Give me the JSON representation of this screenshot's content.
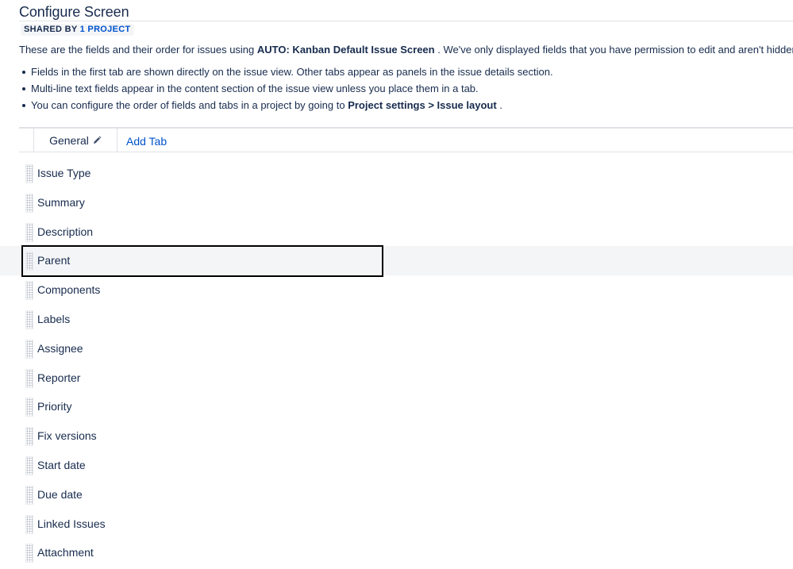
{
  "page": {
    "title": "Configure Screen",
    "shared_by_label": "SHARED BY",
    "shared_by_link": "1 PROJECT",
    "intro_pre": "These are the fields and their order for issues using ",
    "intro_screen": "AUTO: Kanban Default Issue Screen",
    "intro_post": " . We've only displayed fields that you have permission to edit and aren't hidden.",
    "bullet_1": "Fields in the first tab are shown directly on the issue view. Other tabs appear as panels in the issue details section.",
    "bullet_2": "Multi-line text fields appear in the content section of the issue view unless you place them in a tab.",
    "bullet_3_pre": "You can configure the order of fields and tabs in a project by going to ",
    "bullet_3_bold": "Project settings > Issue layout",
    "bullet_3_post": " ."
  },
  "tabs": {
    "general": "General",
    "add": "Add Tab"
  },
  "fields": [
    "Issue Type",
    "Summary",
    "Description",
    "Parent",
    "Components",
    "Labels",
    "Assignee",
    "Reporter",
    "Priority",
    "Fix versions",
    "Start date",
    "Due date",
    "Linked Issues",
    "Attachment"
  ],
  "icons": {
    "tab_edit": "pencil-icon",
    "row_handle": "drag-handle-icon"
  },
  "colors": {
    "text": "#172b4d",
    "link": "#0052cc",
    "hover_row": "#f4f5f7",
    "focus_outline": "#000000"
  }
}
